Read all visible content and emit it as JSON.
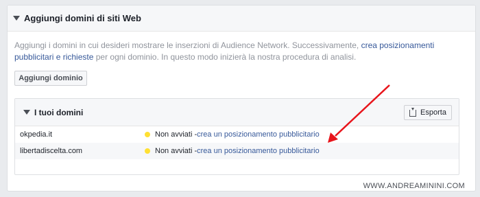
{
  "panel": {
    "title": "Aggiungi domini di siti Web",
    "description_text": "Aggiungi i domini in cui desideri mostrare le inserzioni di Audience Network. Successivamente, ",
    "description_link": "crea posizionamenti pubblicitari e richieste",
    "description_tail": " per ogni dominio. In questo modo inizierà la nostra procedura di analisi.",
    "add_button": "Aggiungi dominio"
  },
  "domains_panel": {
    "title": "I tuoi domini",
    "export_button": "Esporta",
    "rows": [
      {
        "domain": "okpedia.it",
        "status": "Non avviati - ",
        "action": "crea un posizionamento pubblicitario"
      },
      {
        "domain": "libertadiscelta.com",
        "status": "Non avviati - ",
        "action": "crea un posizionamento pubblicitario"
      }
    ]
  },
  "watermark": "WWW.ANDREAMININI.COM",
  "colors": {
    "link": "#365899",
    "status_dot": "#ffe033",
    "annotation_arrow": "#e8141b"
  },
  "icons": [
    "caret-down-icon",
    "export-icon",
    "status-dot-icon",
    "annotation-arrow"
  ]
}
